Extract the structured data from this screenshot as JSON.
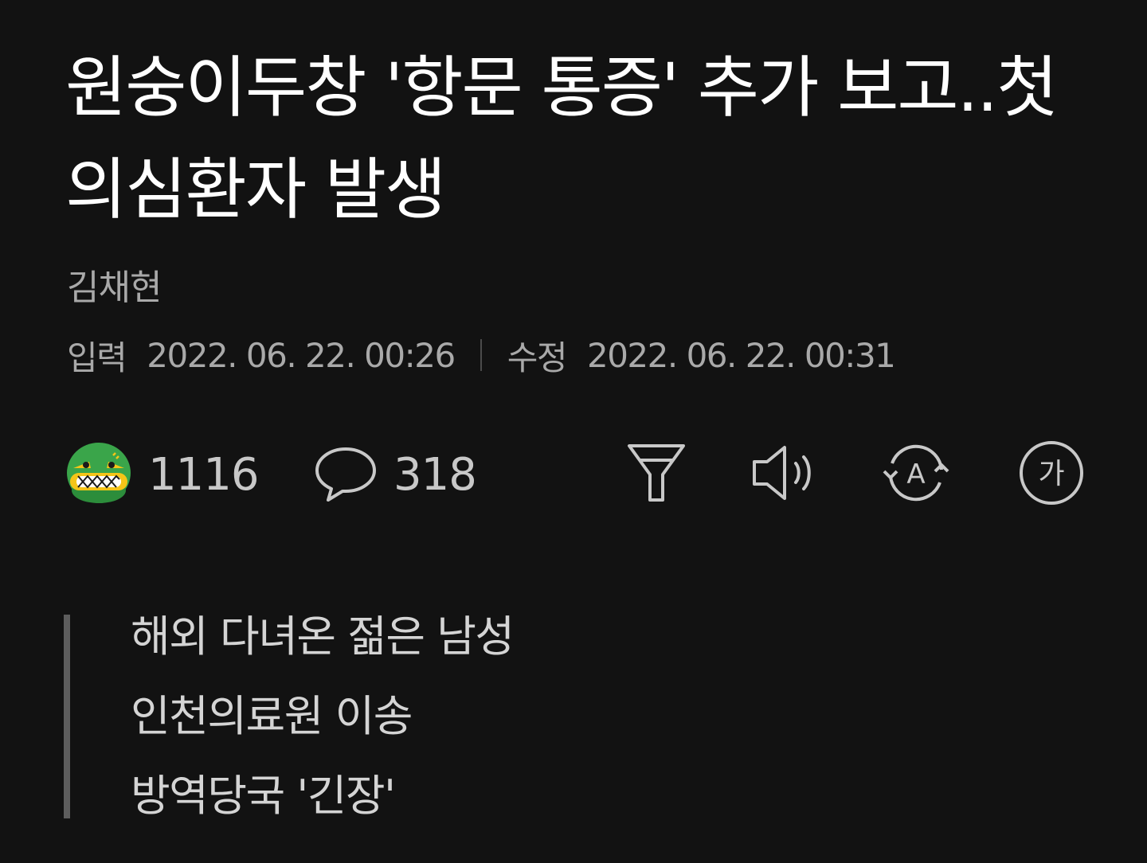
{
  "article": {
    "title": "원숭이두창 '항문 통증' 추가 보고..첫 의심환자 발생",
    "author": "김채현",
    "published_label": "입력",
    "published_time": "2022. 06. 22. 00:26",
    "modified_label": "수정",
    "modified_time": "2022. 06. 22. 00:31"
  },
  "toolbar": {
    "reaction_icon": "angry-face-emoji-icon",
    "reaction_count": "1116",
    "comment_icon": "speech-bubble-icon",
    "comment_count": "318",
    "summary_icon": "funnel-icon",
    "listen_icon": "speaker-icon",
    "translate_icon": "translate-a-icon",
    "font_size_icon": "font-size-icon",
    "font_size_glyph": "가",
    "translate_glyph": "A"
  },
  "summary": {
    "lines": [
      "해외 다녀온 젊은 남성",
      "인천의료원 이송",
      "방역당국 '긴장'"
    ]
  },
  "colors": {
    "background": "#121212",
    "title": "#ffffff",
    "meta": "#a9a9a9",
    "icon": "#c8c8c8",
    "emoji_green": "#3aa54a",
    "emoji_yellow": "#f5c518"
  }
}
